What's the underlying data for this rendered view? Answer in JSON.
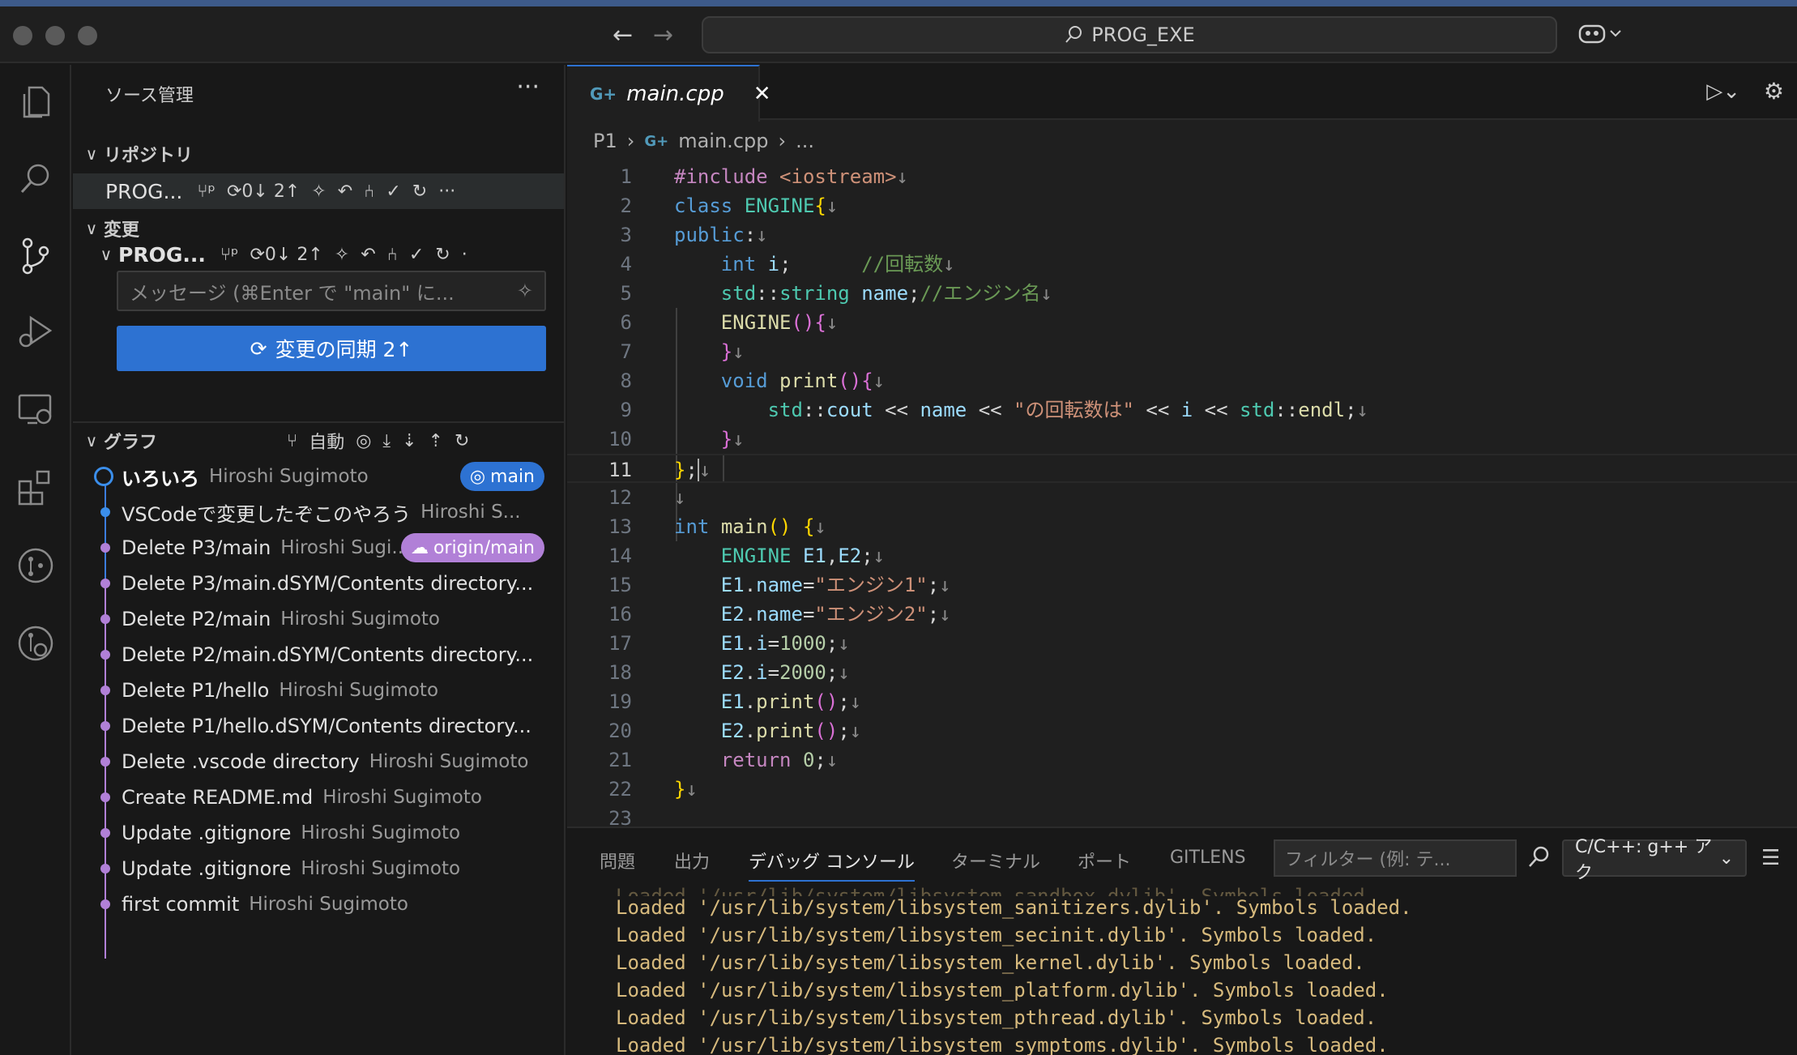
{
  "titlebar": {
    "search_text": "PROG_EXE"
  },
  "sidebar": {
    "title": "ソース管理",
    "repos_section": "リポジトリ",
    "repo_name": "PROG...",
    "repo_counts": "0↓ 2↑",
    "changes_section": "変更",
    "changes_repo": "PROG...",
    "changes_counts": "0↓ 2↑",
    "commit_placeholder": "メッセージ (⌘Enter で \"main\" に...",
    "sync_label": "変更の同期 2↑",
    "graph_section": "グラフ",
    "graph_auto": "自動",
    "commits": [
      {
        "msg": "いろいろ",
        "author": "Hiroshi Sugimoto",
        "badge": "main"
      },
      {
        "msg": "VSCodeで変更したぞこのやろう",
        "author": "Hiroshi S..."
      },
      {
        "msg": "Delete P3/main",
        "author": "Hiroshi Sugi...",
        "badge": "origin/main"
      },
      {
        "msg": "Delete P3/main.dSYM/Contents directory...",
        "author": ""
      },
      {
        "msg": "Delete P2/main",
        "author": "Hiroshi Sugimoto"
      },
      {
        "msg": "Delete P2/main.dSYM/Contents directory...",
        "author": ""
      },
      {
        "msg": "Delete P1/hello",
        "author": "Hiroshi Sugimoto"
      },
      {
        "msg": "Delete P1/hello.dSYM/Contents directory...",
        "author": ""
      },
      {
        "msg": "Delete .vscode directory",
        "author": "Hiroshi Sugimoto"
      },
      {
        "msg": "Create README.md",
        "author": "Hiroshi Sugimoto"
      },
      {
        "msg": "Update .gitignore",
        "author": "Hiroshi Sugimoto"
      },
      {
        "msg": "Update .gitignore",
        "author": "Hiroshi Sugimoto"
      },
      {
        "msg": "first commit",
        "author": "Hiroshi Sugimoto"
      }
    ]
  },
  "editor": {
    "tab_label": "main.cpp",
    "breadcrumb": [
      "P1",
      "main.cpp",
      "..."
    ],
    "line_numbers": [
      "1",
      "2",
      "3",
      "4",
      "5",
      "6",
      "7",
      "8",
      "9",
      "10",
      "11",
      "12",
      "13",
      "14",
      "15",
      "16",
      "17",
      "18",
      "19",
      "20",
      "21",
      "22",
      "23"
    ],
    "active_line": "11"
  },
  "panel": {
    "tabs": [
      "問題",
      "出力",
      "デバッグ コンソール",
      "ターミナル",
      "ポート",
      "GITLENS"
    ],
    "filter_placeholder": "フィルター (例: テ...",
    "debug_config": "C/C++: g++ アク",
    "output": [
      "Loaded '/usr/lib/system/libsystem_sanitizers.dylib'. Symbols loaded.",
      "Loaded '/usr/lib/system/libsystem_secinit.dylib'. Symbols loaded.",
      "Loaded '/usr/lib/system/libsystem_kernel.dylib'. Symbols loaded.",
      "Loaded '/usr/lib/system/libsystem_platform.dylib'. Symbols loaded.",
      "Loaded '/usr/lib/system/libsystem_pthread.dylib'. Symbols loaded.",
      "Loaded '/usr/lib/system/libsystem_symptoms.dylib'. Symbols loaded."
    ]
  },
  "colors": {
    "accent": "#2d72d2",
    "graph_purple": "#b180d7",
    "badge_blue": "#2d72d2",
    "badge_purple": "#b180d7"
  }
}
